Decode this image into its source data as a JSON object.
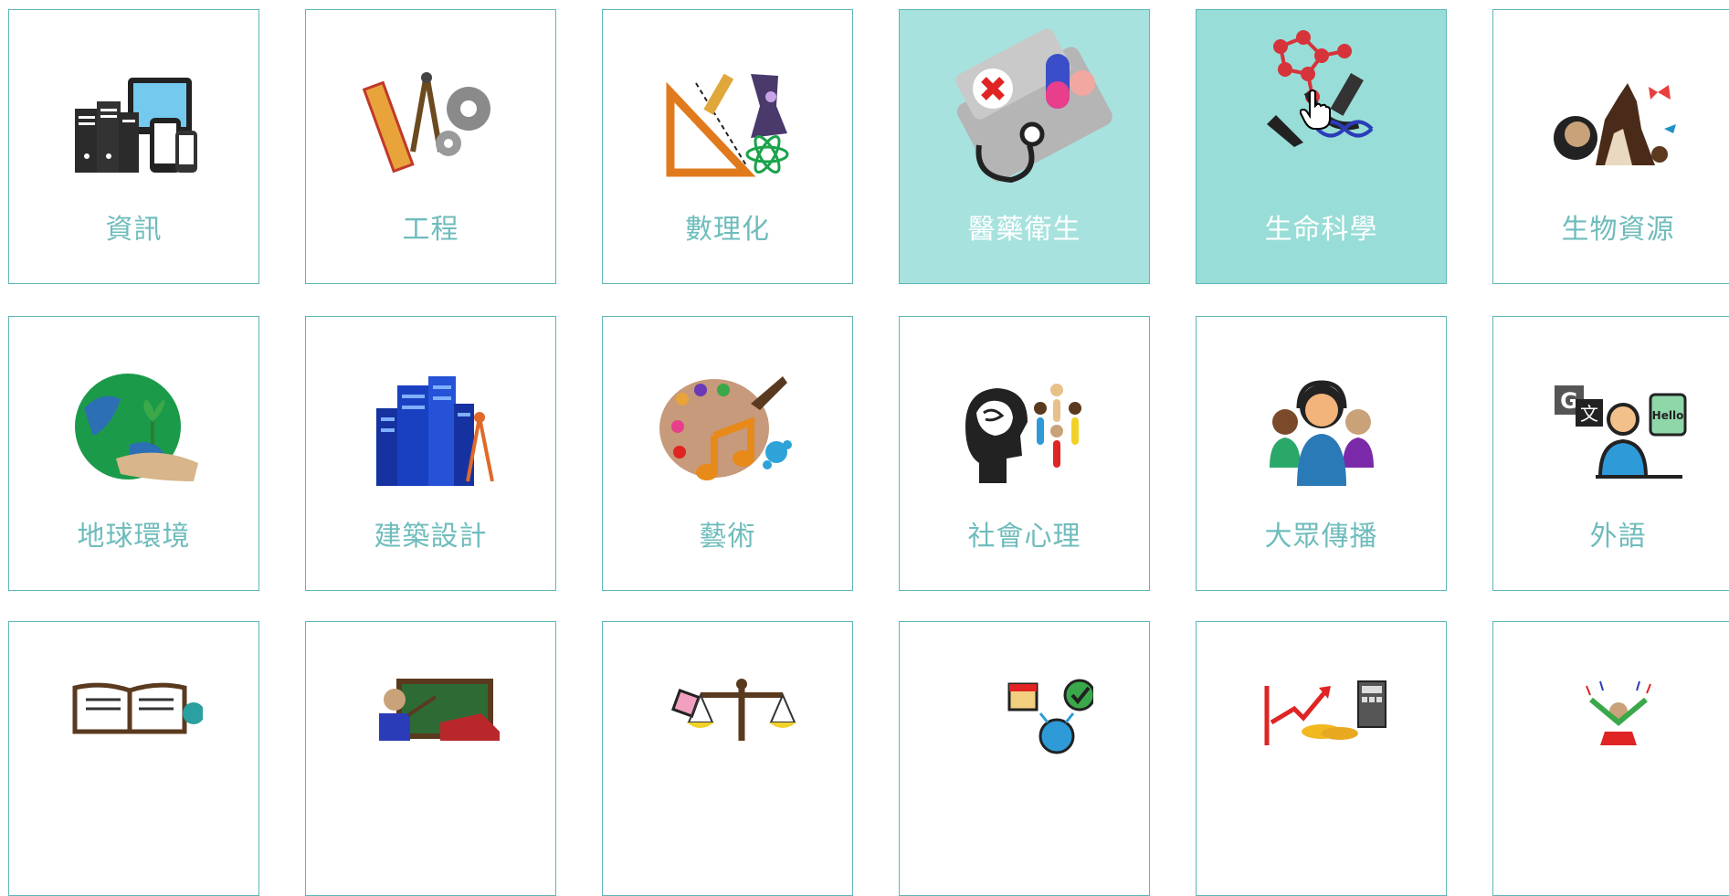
{
  "grid": {
    "tiles": [
      {
        "label": "資訊",
        "icon": "computer-devices-icon",
        "state": "normal"
      },
      {
        "label": "工程",
        "icon": "engineering-tools-icon",
        "state": "normal"
      },
      {
        "label": "數理化",
        "icon": "math-science-icon",
        "state": "normal"
      },
      {
        "label": "醫藥衛生",
        "icon": "medicine-health-icon",
        "state": "active"
      },
      {
        "label": "生命科學",
        "icon": "life-science-icon",
        "state": "hovered"
      },
      {
        "label": "生物資源",
        "icon": "bio-resources-icon",
        "state": "normal"
      },
      {
        "label": "地球環境",
        "icon": "earth-environment-icon",
        "state": "normal"
      },
      {
        "label": "建築設計",
        "icon": "architecture-icon",
        "state": "normal"
      },
      {
        "label": "藝術",
        "icon": "art-palette-icon",
        "state": "normal"
      },
      {
        "label": "社會心理",
        "icon": "social-psychology-icon",
        "state": "normal"
      },
      {
        "label": "大眾傳播",
        "icon": "mass-communication-icon",
        "state": "normal"
      },
      {
        "label": "外語",
        "icon": "foreign-language-icon",
        "state": "normal"
      },
      {
        "label": "",
        "icon": "literature-books-icon",
        "state": "normal"
      },
      {
        "label": "",
        "icon": "education-teacher-icon",
        "state": "normal"
      },
      {
        "label": "",
        "icon": "law-scales-icon",
        "state": "normal"
      },
      {
        "label": "",
        "icon": "management-planning-icon",
        "state": "normal"
      },
      {
        "label": "",
        "icon": "finance-growth-icon",
        "state": "normal"
      },
      {
        "label": "",
        "icon": "sports-leisure-icon",
        "state": "normal"
      }
    ]
  },
  "colors": {
    "border": "#5fb7b8",
    "label": "#6fbcbc",
    "active_bg": "#a7e2de",
    "hover_bg": "#98ddd7"
  }
}
